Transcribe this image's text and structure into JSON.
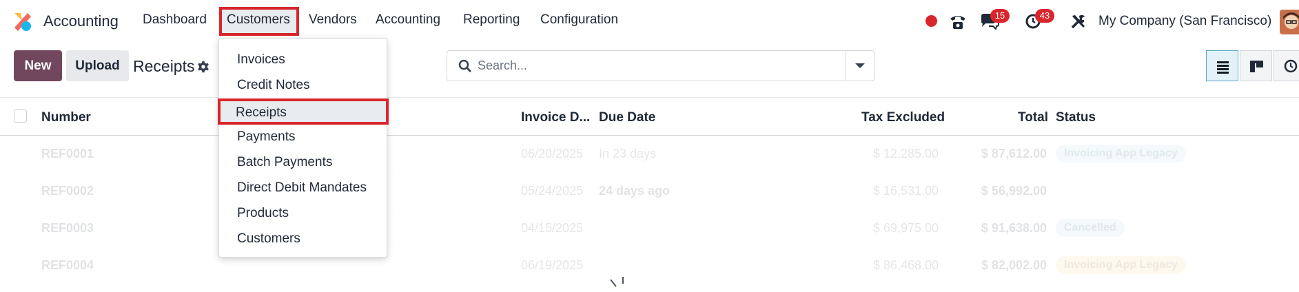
{
  "navbar": {
    "app_name": "Accounting",
    "menus": [
      "Dashboard",
      "Customers",
      "Vendors",
      "Accounting",
      "Reporting",
      "Configuration"
    ],
    "active_menu": "Customers",
    "messages_badge": "15",
    "activities_badge": "43",
    "company": "My Company (San Francisco)",
    "accent_color": "#d9262c"
  },
  "control_panel": {
    "new_label": "New",
    "upload_label": "Upload",
    "title": "Receipts",
    "search_placeholder": "Search...",
    "primary_color": "#71475d"
  },
  "list": {
    "columns": [
      "Number",
      "Invoice D...",
      "Due Date",
      "Tax Excluded",
      "Total",
      "Status"
    ],
    "rows": [
      {
        "number": "REF0001",
        "invoice_date": "06/20/2025",
        "due_date": "In 23 days",
        "tax_excluded": "$ 12,285.00",
        "total": "$ 87,612.00",
        "status": "Invoicing App Legacy"
      },
      {
        "number": "REF0002",
        "invoice_date": "05/24/2025",
        "due_date": "24 days ago",
        "tax_excluded": "$ 16,531.00",
        "total": "$ 56,992.00",
        "status": ""
      },
      {
        "number": "REF0003",
        "invoice_date": "04/15/2025",
        "due_date": "",
        "tax_excluded": "$ 69,975.00",
        "total": "$ 91,638.00",
        "status": "Cancelled"
      },
      {
        "number": "REF0004",
        "invoice_date": "06/19/2025",
        "due_date": "",
        "tax_excluded": "$ 86,468.00",
        "total": "$ 82,002.00",
        "status": "Invoicing App Legacy"
      }
    ]
  },
  "dropdown": {
    "items": [
      "Invoices",
      "Credit Notes",
      "Receipts",
      "Payments",
      "Batch Payments",
      "Direct Debit Mandates",
      "Products",
      "Customers"
    ],
    "highlighted": "Receipts"
  }
}
